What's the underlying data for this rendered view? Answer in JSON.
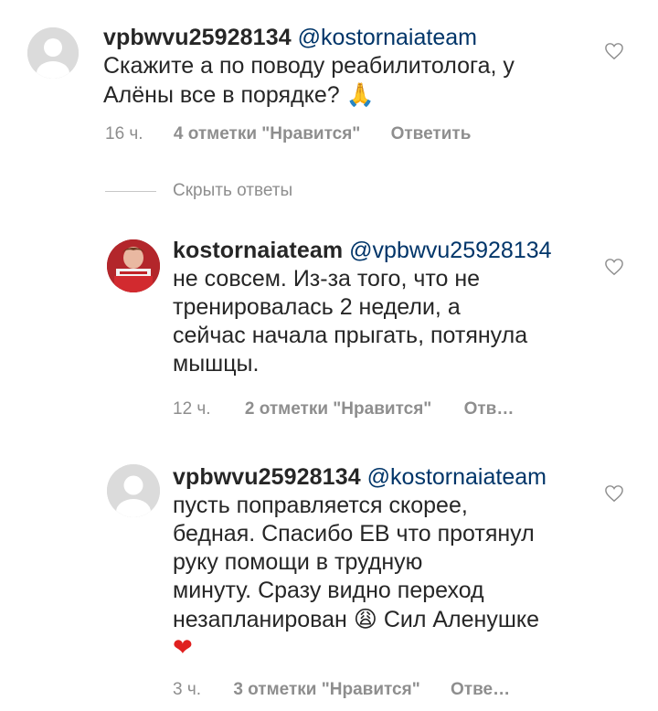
{
  "comments": [
    {
      "username": "vpbwvu25928134",
      "mention": "@kostornaiateam",
      "text_line1": "Скажите а по поводу реабилитолога, у",
      "text_line2": "Алёны все в порядке?",
      "emoji": "🙏",
      "time": "16 ч.",
      "likes": "4 отметки \"Нравится\"",
      "reply": "Ответить",
      "avatar_icon": "default-user-avatar"
    },
    {
      "username": "kostornaiateam",
      "mention": "@vpbwvu25928134",
      "text_lines": [
        "не совсем. Из-за того, что не",
        "тренировалась 2 недели, а",
        "сейчас начала прыгать, потянула",
        "мышцы."
      ],
      "time": "12 ч.",
      "likes": "2 отметки \"Нравится\"",
      "reply": "Отв…",
      "avatar_icon": "profile-photo-avatar"
    },
    {
      "username": "vpbwvu25928134",
      "mention": "@kostornaiateam",
      "text_lines": [
        "пусть поправляется скорее,",
        "бедная. Спасибо ЕВ что протянул",
        "руку помощи в трудную",
        "минуту. Сразу видно переход"
      ],
      "text_line5": "незапланирован",
      "emoji_tired": "😩",
      "text_line5_tail": "Сил Аленушке",
      "emoji_heart": "❤",
      "time": "3 ч.",
      "likes": "3 отметки \"Нравится\"",
      "reply": "Отве…",
      "avatar_icon": "default-user-avatar"
    }
  ],
  "hide_replies": "Скрыть ответы",
  "colors": {
    "mention": "#003569",
    "meta": "#8e8e8e",
    "heart_outline": "#8e8e8e",
    "red_heart": "#e0201f"
  }
}
